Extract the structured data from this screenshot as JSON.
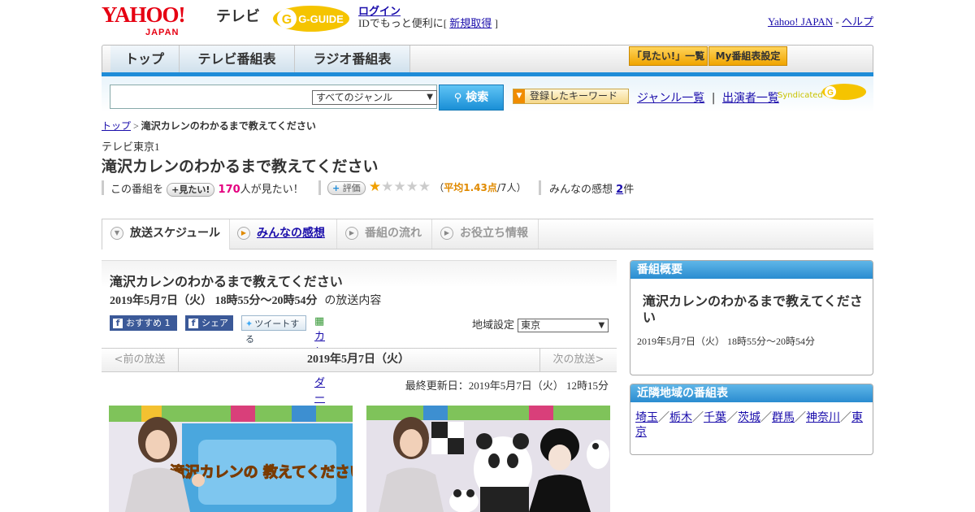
{
  "header": {
    "logo": "YAHOO!",
    "logo_sub": "JAPAN",
    "tv_label": "テレビ",
    "gguide_logo": "G-GUIDE",
    "login": "ログイン",
    "login_note_prefix": "IDでもっと便利に[ ",
    "signup": "新規取得",
    "login_note_suffix": " ]",
    "yahoo_japan_link": "Yahoo! JAPAN",
    "help_sep": " - ",
    "help": "ヘルプ"
  },
  "nav": {
    "tabs": [
      "トップ",
      "テレビ番組表",
      "ラジオ番組表"
    ],
    "mitai_list": "「見たい!」一覧",
    "my_settings": "My番組表設定"
  },
  "search": {
    "placeholder": "",
    "genre_selected": "すべてのジャンル",
    "button": "検索",
    "keyword_button": "登録したキーワード",
    "genre_list": "ジャンル一覧",
    "link_sep": "|",
    "performers": "出演者一覧",
    "syndicated": "Syndicated"
  },
  "breadcrumb": {
    "top": "トップ",
    "sep": " > ",
    "current": "滝沢カレンのわかるまで教えてください"
  },
  "program": {
    "channel": "テレビ東京1",
    "title": "滝沢カレンのわかるまで教えてください",
    "mitai_prefix": "この番組を",
    "mitai_badge": "+見たい!",
    "mitai_count": "170",
    "mitai_suffix": "人が見たい！",
    "rating_label": "評価",
    "rating_stars": 1,
    "rating_open": "（",
    "rating_avg": "平均1.43点",
    "rating_count": "/7人",
    "rating_close": "）",
    "impressions_label": "みんなの感想",
    "impressions_count": "2",
    "impressions_unit": "件"
  },
  "subtabs": [
    "放送スケジュール",
    "みんなの感想",
    "番組の流れ",
    "お役立ち情報"
  ],
  "episode": {
    "title": "滝沢カレンのわかるまで教えてください",
    "date": "2019年5月7日（火） 18時55分～20時54分",
    "date_suffix": "の放送内容",
    "fb_recommend": "おすすめ 1",
    "fb_share": "シェア",
    "tweet": "ツイートする",
    "calendar": "カレンダーに登録",
    "region_label": "地域設定",
    "region_selected": "東京"
  },
  "datebar": {
    "prev": "<前の放送",
    "current": "2019年5月7日（火）",
    "next": "次の放送>"
  },
  "updated": "最終更新日：2019年5月7日（火） 12時15分",
  "thumbs": {
    "sign_text": "滝沢カレンの 教えてください"
  },
  "side": {
    "overview_header": "番組概要",
    "overview_title": "滝沢カレンのわかるまで教えてください",
    "overview_date": "2019年5月7日（火） 18時55分～20時54分",
    "nearby_header": "近隣地域の番組表",
    "nearby_regions": [
      "埼玉",
      "栃木",
      "千葉",
      "茨城",
      "群馬",
      "神奈川",
      "東京"
    ]
  },
  "colors": {
    "accent_blue": "#1e8cd8",
    "yahoo_red": "#e60012",
    "highlight_pink": "#e4007f",
    "orange": "#f0a400"
  }
}
